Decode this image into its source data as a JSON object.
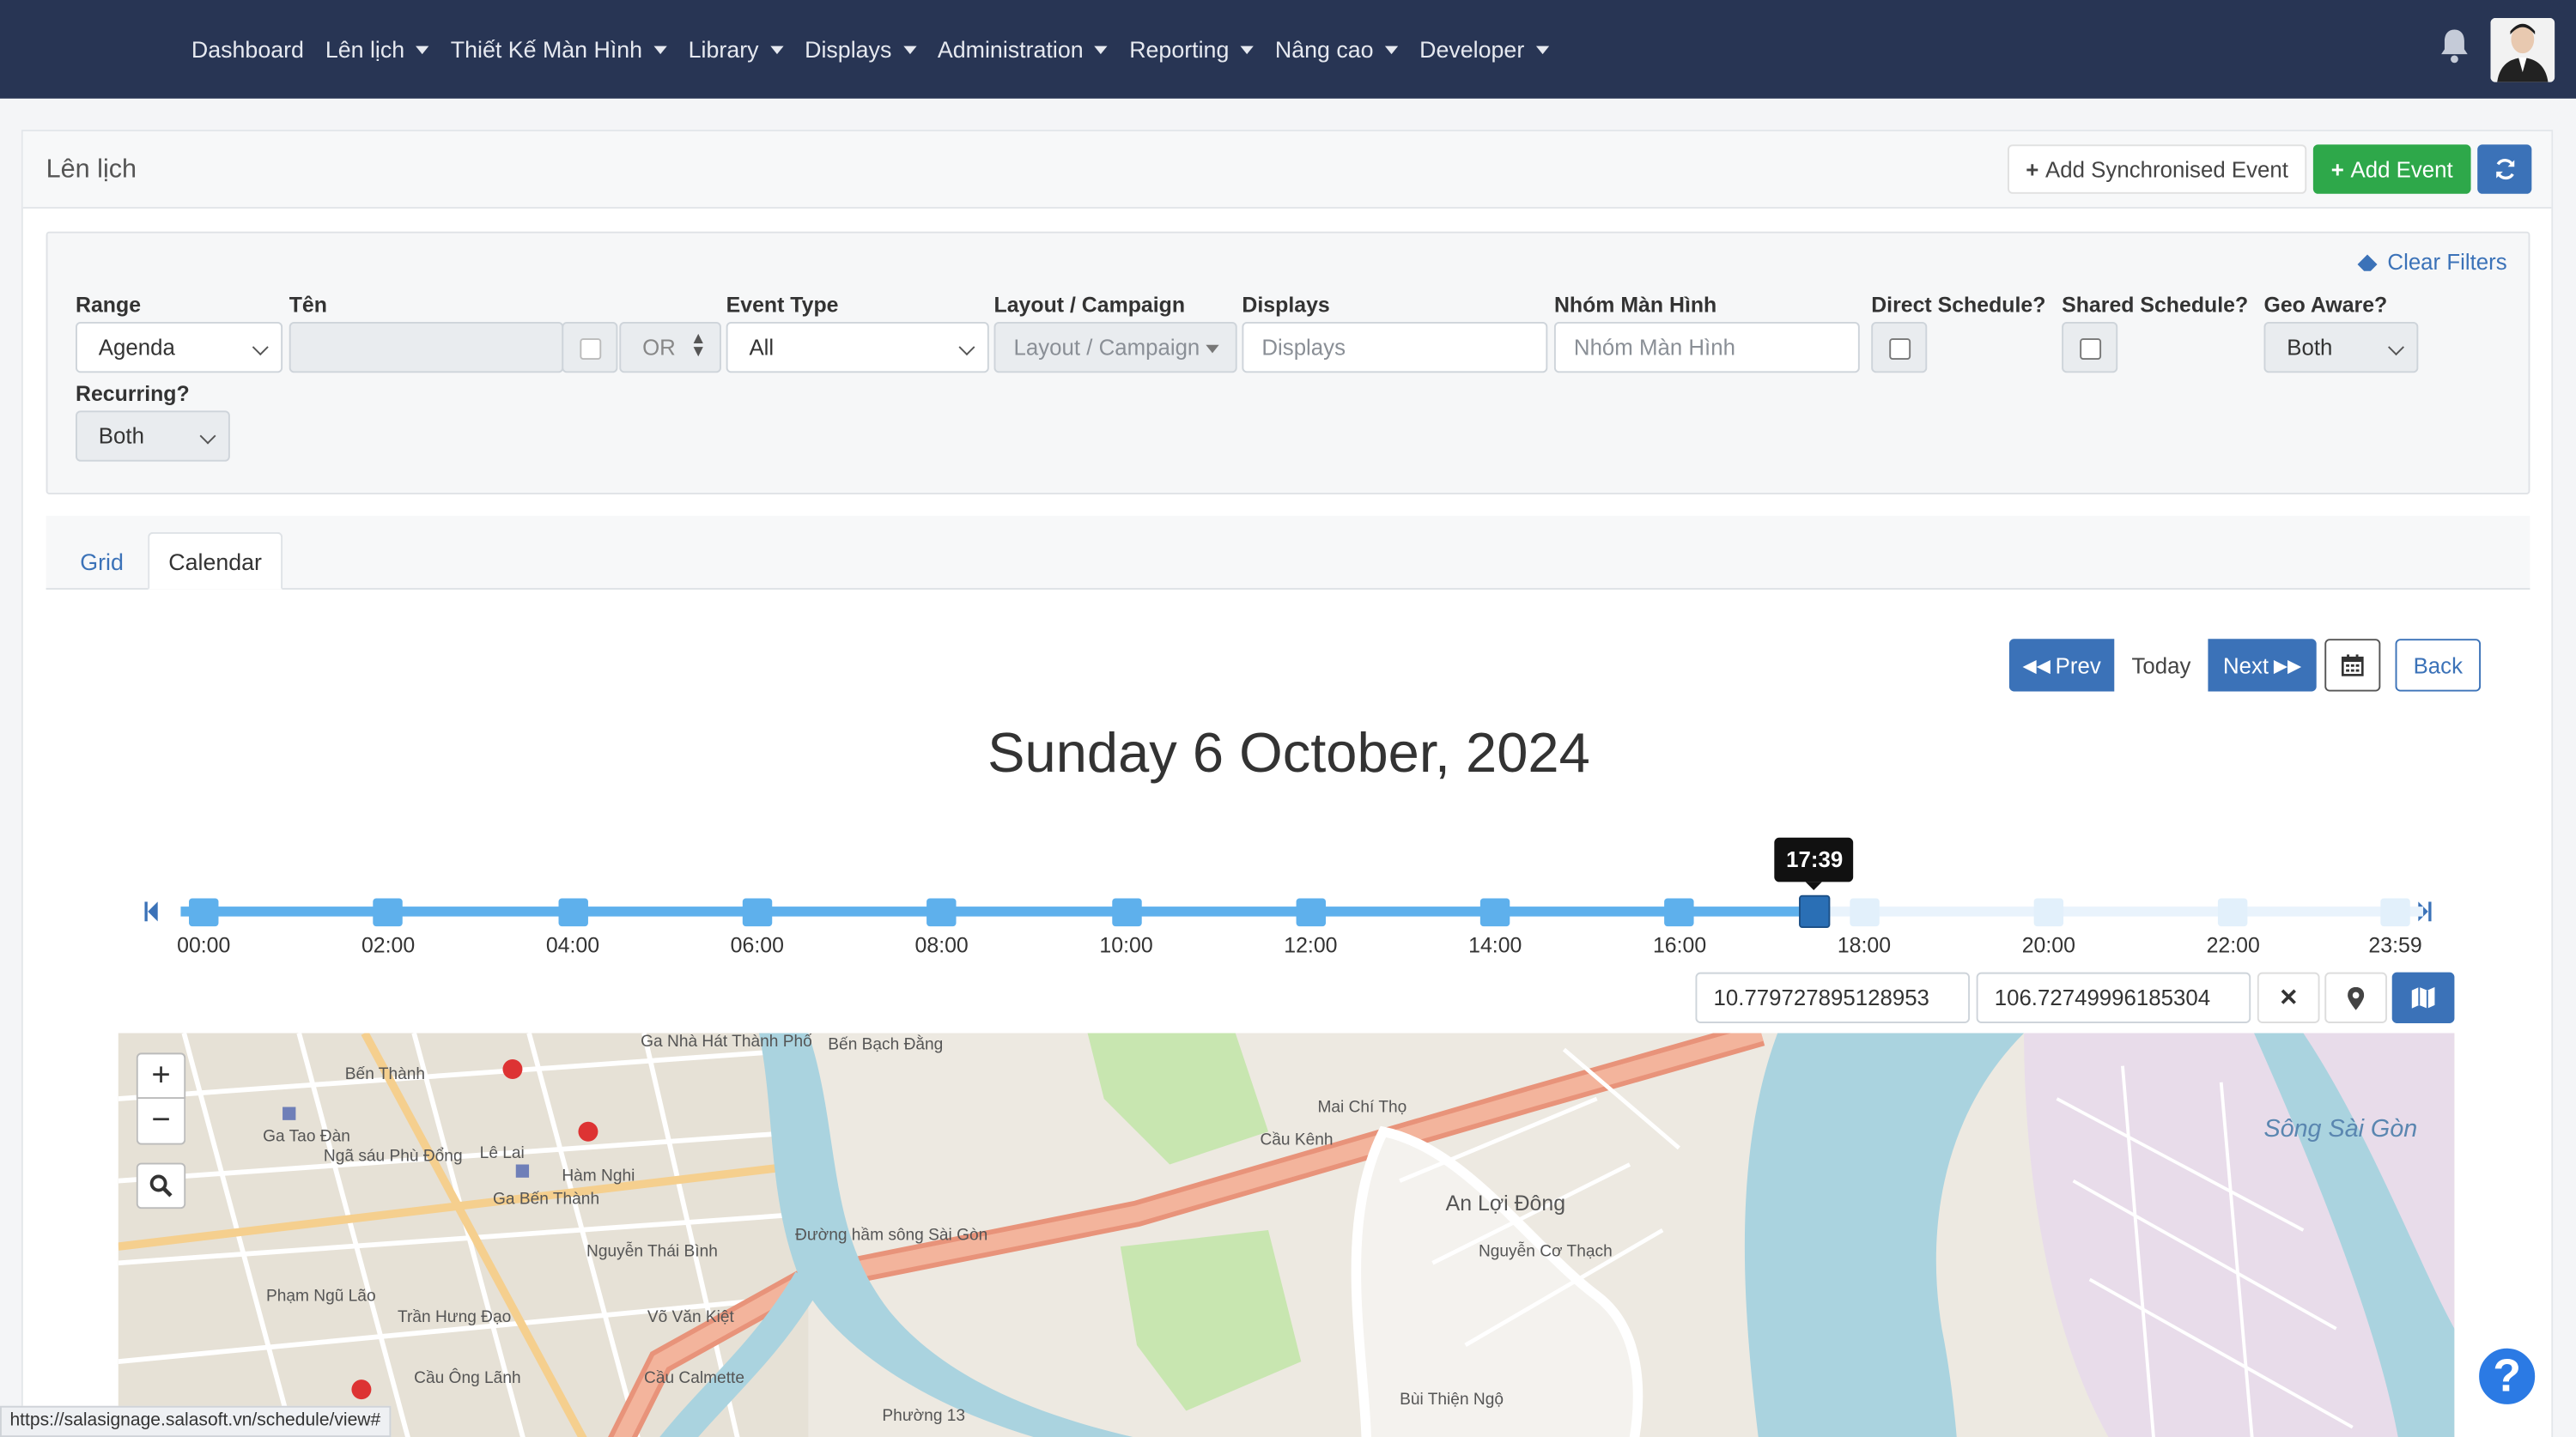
{
  "nav": {
    "items": [
      {
        "label": "Dashboard",
        "caret": false
      },
      {
        "label": "Lên lịch",
        "caret": true
      },
      {
        "label": "Thiết Kế Màn Hình",
        "caret": true
      },
      {
        "label": "Library",
        "caret": true
      },
      {
        "label": "Displays",
        "caret": true
      },
      {
        "label": "Administration",
        "caret": true
      },
      {
        "label": "Reporting",
        "caret": true
      },
      {
        "label": "Nâng cao",
        "caret": true
      },
      {
        "label": "Developer",
        "caret": true
      }
    ]
  },
  "header": {
    "title": "Lên lịch",
    "add_sync_label": "Add Synchronised Event",
    "add_event_label": "Add Event"
  },
  "filters": {
    "clear_label": "Clear Filters",
    "range_label": "Range",
    "range_value": "Agenda",
    "name_label": "Tên",
    "name_value": "",
    "logic_value": "OR",
    "event_type_label": "Event Type",
    "event_type_value": "All",
    "layout_label": "Layout / Campaign",
    "layout_placeholder": "Layout / Campaign",
    "displays_label": "Displays",
    "displays_placeholder": "Displays",
    "group_label": "Nhóm Màn Hình",
    "group_placeholder": "Nhóm Màn Hình",
    "direct_label": "Direct Schedule?",
    "shared_label": "Shared Schedule?",
    "geo_label": "Geo Aware?",
    "geo_value": "Both",
    "recurring_label": "Recurring?",
    "recurring_value": "Both"
  },
  "tabs": {
    "grid": "Grid",
    "calendar": "Calendar"
  },
  "calendar": {
    "prev_label": "Prev",
    "today_label": "Today",
    "next_label": "Next",
    "back_label": "Back",
    "date_title": "Sunday 6 October, 2024"
  },
  "timeline": {
    "current_time": "17:39",
    "ticks": [
      "00:00",
      "02:00",
      "04:00",
      "06:00",
      "08:00",
      "10:00",
      "12:00",
      "14:00",
      "16:00",
      "18:00",
      "20:00",
      "22:00",
      "23:59"
    ],
    "progress_fraction": 0.735
  },
  "geo": {
    "lat": "10.779727895128953",
    "lng": "106.72749996185304"
  },
  "map": {
    "labels": [
      "Bến Thành",
      "Ga Tao Đàn",
      "Ngã sáu Phù Đổng",
      "Lê Lai",
      "Ga Bến Thành",
      "Hàm Nghi",
      "Nguyễn Thái Bình",
      "Phạm Ngũ Lão",
      "Cầu Ông Lãnh",
      "Cầu Calmette",
      "Ga Nhà Hát Thành Phố",
      "Bến Bạch Đằng",
      "Đường hầm sông Sài Gòn",
      "Cầu Kênh",
      "Mai Chí Thọ",
      "An Lợi Đông",
      "Sông Sài Gòn",
      "Bùi Thiện Ngộ",
      "Phường 13",
      "Nguyễn Cơ Thạch",
      "Võ Văn Kiệt",
      "Trần Hưng Đạo"
    ]
  },
  "status_url": "https://salasignage.salasoft.vn/schedule/view#",
  "colors": {
    "navbar": "#283554",
    "primary": "#3b72b8",
    "success": "#2ea84a",
    "track": "#5eb0ec"
  }
}
